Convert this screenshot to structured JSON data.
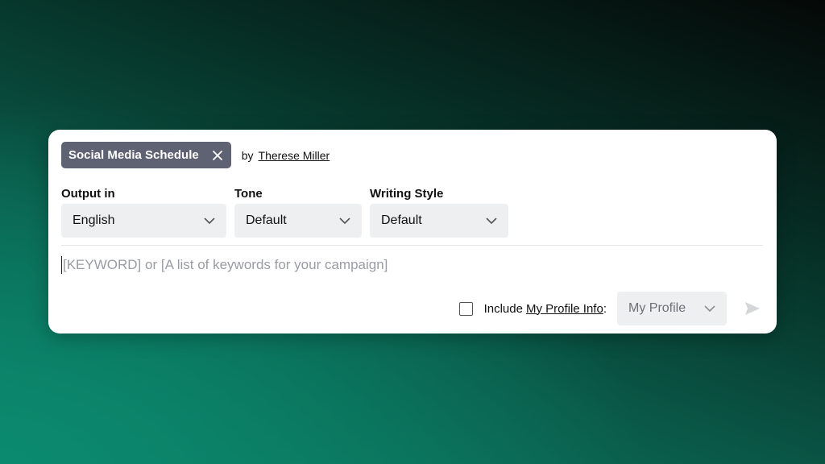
{
  "prompt_chip": {
    "title": "Social Media Schedule",
    "close_icon": "close-icon"
  },
  "author": {
    "by_label": "by",
    "name": "Therese Miller"
  },
  "fields": {
    "output": {
      "label": "Output in",
      "value": "English"
    },
    "tone": {
      "label": "Tone",
      "value": "Default"
    },
    "style": {
      "label": "Writing Style",
      "value": "Default"
    }
  },
  "prompt_input": {
    "placeholder": "[KEYWORD] or [A list of keywords for your campaign]"
  },
  "footer": {
    "include_label": "Include",
    "profile_link": "My Profile Info",
    "colon": ":",
    "profile_select_value": "My Profile",
    "checkbox_checked": false,
    "send_icon": "send-icon"
  },
  "colors": {
    "chip_bg": "#5f6272",
    "select_bg": "#eeeff1",
    "placeholder": "#9a9ca3",
    "background_accent": "#0b8a6f"
  }
}
